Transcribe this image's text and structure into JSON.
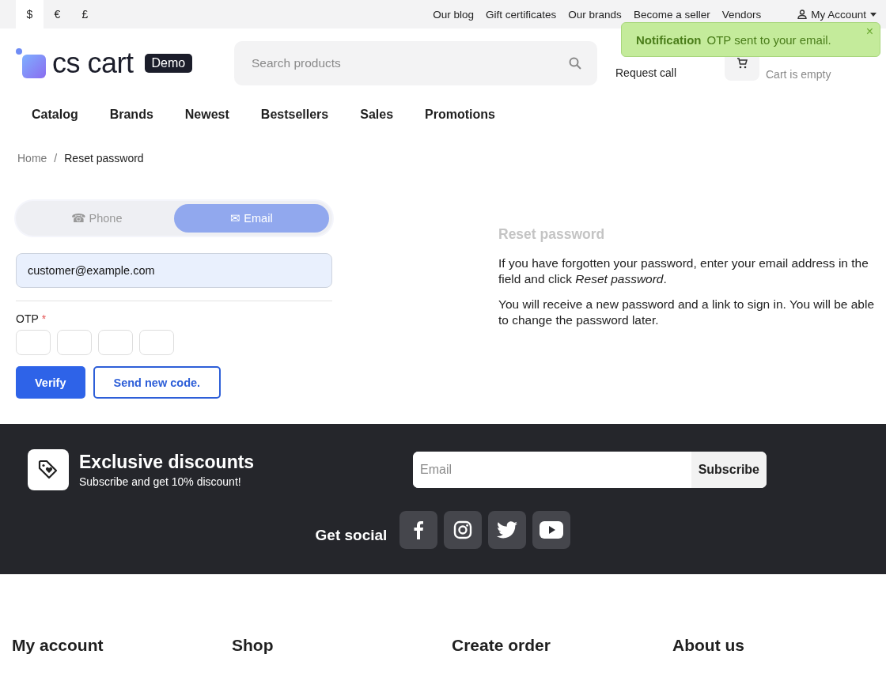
{
  "top_bar": {
    "currencies": [
      {
        "label": "$",
        "selected": true
      },
      {
        "label": "€",
        "selected": false
      },
      {
        "label": "£",
        "selected": false
      }
    ],
    "links": [
      "Our blog",
      "Gift certificates",
      "Our brands",
      "Become a seller",
      "Vendors"
    ],
    "account": "My Account"
  },
  "notification": {
    "title": "Notification",
    "message": "OTP sent to your email.",
    "close": "×"
  },
  "header": {
    "logo": "cs cart",
    "logo_badge": "Demo",
    "search": {
      "placeholder": "Search products"
    },
    "request_call": "Request call",
    "cart_status": "Cart is empty"
  },
  "nav": [
    "Catalog",
    "Brands",
    "Newest",
    "Bestsellers",
    "Sales",
    "Promotions"
  ],
  "breadcrumb": [
    "Home",
    "Reset password"
  ],
  "breadcrumb_separator": "/",
  "form": {
    "tabs": [
      {
        "label": "☎ Phone",
        "selected": false
      },
      {
        "label": "✉ Email",
        "selected": true
      }
    ],
    "email": {
      "value": "customer@example.com"
    },
    "otp_label": "OTP",
    "required_mark": "*",
    "buttons": [
      {
        "label": "Verify",
        "kind": "primary"
      },
      {
        "label": "Send new code.",
        "kind": "outline"
      }
    ]
  },
  "info": {
    "title": "Reset password",
    "paragraphs": [
      "If you have forgotten your password, enter your email address in the field and click *Reset password*.",
      "You will receive a new password and a link to sign in. You will be able to change the password later."
    ]
  },
  "footer": {
    "promo_title": "Exclusive discounts",
    "promo_text": "Subscribe and get 10% discount!",
    "email_placeholder": "Email",
    "subscribe": "Subscribe",
    "social_label": "Get social",
    "social": [
      {
        "kind": "facebook"
      },
      {
        "kind": "instagram"
      },
      {
        "kind": "twitter"
      },
      {
        "kind": "youtube"
      }
    ]
  },
  "footer_columns": [
    "My account",
    "Shop",
    "Create order",
    "About us"
  ]
}
